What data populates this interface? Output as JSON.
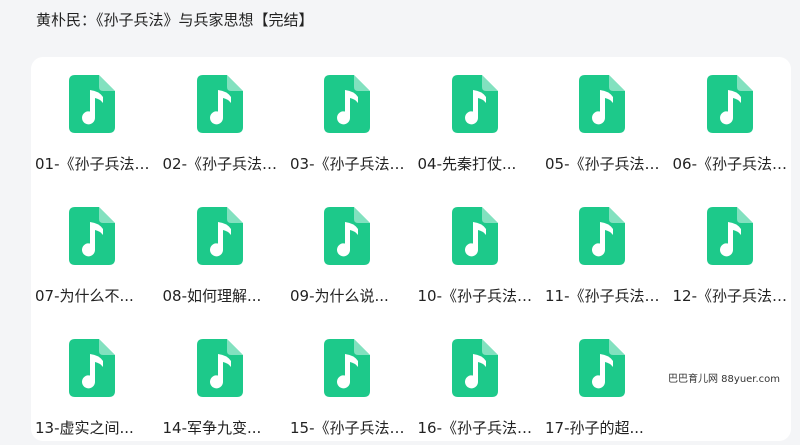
{
  "folder": {
    "title": "黄朴民：《孙子兵法》与兵家思想【完结】"
  },
  "colors": {
    "audio_icon": "#1dc98a",
    "background": "#f4f5f7",
    "panel": "#ffffff"
  },
  "files": [
    {
      "name": "01-《孙子兵法》...",
      "icon": "audio-file-icon"
    },
    {
      "name": "02-《孙子兵法》...",
      "icon": "audio-file-icon"
    },
    {
      "name": "03-《孙子兵法》...",
      "icon": "audio-file-icon"
    },
    {
      "name": "04-先秦打仗...",
      "icon": "audio-file-icon"
    },
    {
      "name": "05-《孙子兵法》...",
      "icon": "audio-file-icon"
    },
    {
      "name": "06-《孙子兵法》...",
      "icon": "audio-file-icon"
    },
    {
      "name": "07-为什么不...",
      "icon": "audio-file-icon"
    },
    {
      "name": "08-如何理解...",
      "icon": "audio-file-icon"
    },
    {
      "name": "09-为什么说...",
      "icon": "audio-file-icon"
    },
    {
      "name": "10-《孙子兵法》...",
      "icon": "audio-file-icon"
    },
    {
      "name": "11-《孙子兵法》...",
      "icon": "audio-file-icon"
    },
    {
      "name": "12-《孙子兵法》...",
      "icon": "audio-file-icon"
    },
    {
      "name": "13-虚实之间...",
      "icon": "audio-file-icon"
    },
    {
      "name": "14-军争九变...",
      "icon": "audio-file-icon"
    },
    {
      "name": "15-《孙子兵法》...",
      "icon": "audio-file-icon"
    },
    {
      "name": "16-《孙子兵法》...",
      "icon": "audio-file-icon"
    },
    {
      "name": "17-孙子的超...",
      "icon": "audio-file-icon"
    }
  ],
  "watermark": "巴巴育儿网 88yuer.com"
}
